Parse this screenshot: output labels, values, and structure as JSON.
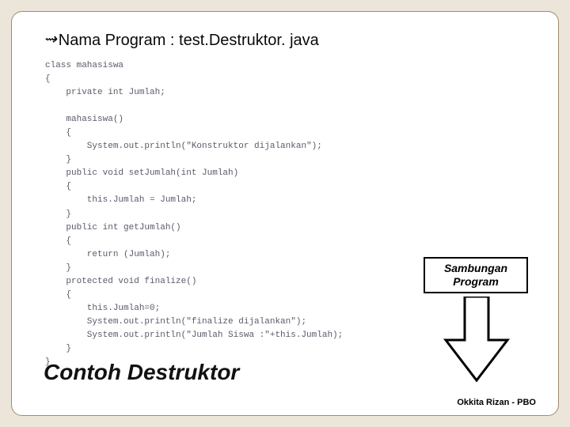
{
  "heading": {
    "bullet": "⇝",
    "text": "Nama Program : test.Destruktor. java"
  },
  "code": {
    "lines": [
      "class mahasiswa",
      "{",
      "    private int Jumlah;",
      "",
      "    mahasiswa()",
      "    {",
      "        System.out.println(\"Konstruktor dijalankan\");",
      "    }",
      "    public void setJumlah(int Jumlah)",
      "    {",
      "        this.Jumlah = Jumlah;",
      "    }",
      "    public int getJumlah()",
      "    {",
      "        return (Jumlah);",
      "    }",
      "    protected void finalize()",
      "    {",
      "        this.Jumlah=0;",
      "        System.out.println(\"finalize dijalankan\");",
      "        System.out.println(\"Jumlah Siswa :\"+this.Jumlah);",
      "    }",
      "}"
    ]
  },
  "callout": {
    "line1": "Sambungan",
    "line2": "Program"
  },
  "slideTitle": "Contoh Destruktor",
  "footer": "Okkita Rizan - PBO"
}
